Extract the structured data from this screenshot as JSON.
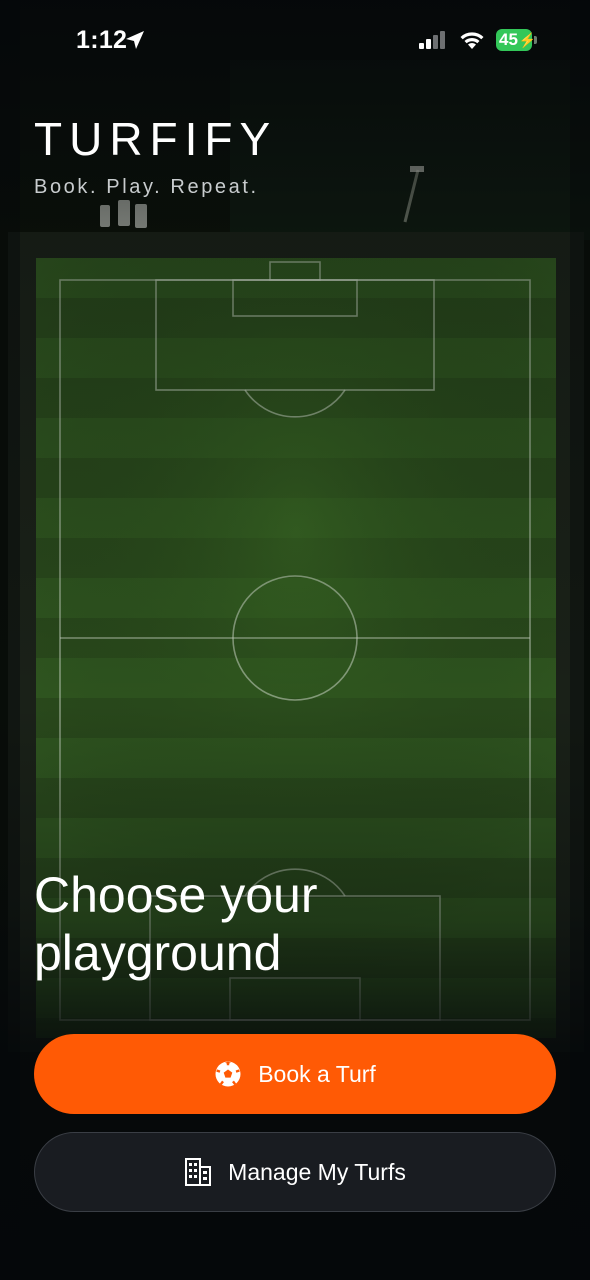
{
  "status_bar": {
    "time": "1:12",
    "battery_level": "45",
    "battery_color": "#33c759",
    "icons": [
      "location-arrow-icon",
      "cellular-signal-icon",
      "wifi-icon",
      "battery-icon"
    ]
  },
  "header": {
    "brand": "TURFIFY",
    "tagline": "Book. Play. Repeat."
  },
  "hero": {
    "headline_line1": "Choose your",
    "headline_line2": "playground"
  },
  "actions": {
    "primary": {
      "label": "Book a Turf",
      "icon": "soccer-ball-icon",
      "color": "#ff5a05"
    },
    "secondary": {
      "label": "Manage My Turfs",
      "icon": "building-icon",
      "color": "#191c21"
    }
  }
}
